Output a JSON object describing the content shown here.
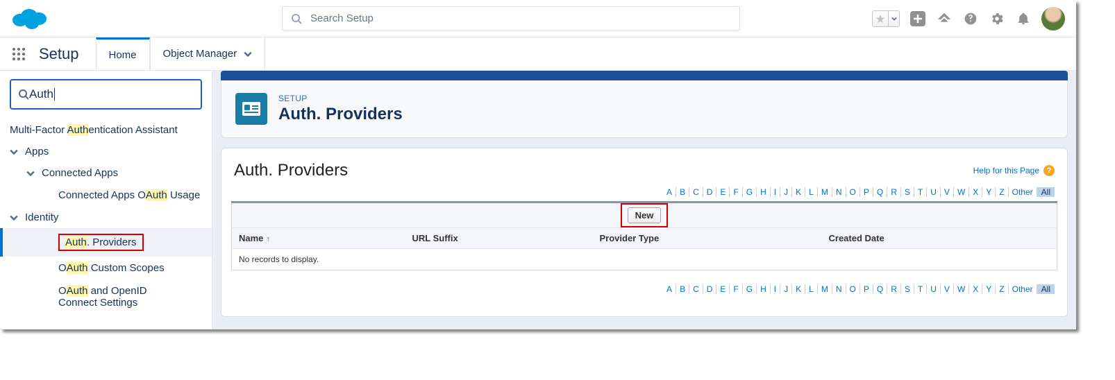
{
  "header": {
    "search_placeholder": "Search Setup"
  },
  "nav": {
    "app_title": "Setup",
    "tab_home": "Home",
    "tab_object_manager": "Object Manager"
  },
  "sidebar": {
    "quickfind_value": "Auth",
    "mfa_prefix": "Multi-Factor ",
    "mfa_hl": "Auth",
    "mfa_suffix": "entication Assistant",
    "apps": "Apps",
    "connected_apps": "Connected Apps",
    "connected_apps_oauth_prefix": "Connected Apps O",
    "connected_apps_oauth_hl": "Auth",
    "connected_apps_oauth_suffix": " Usage",
    "identity": "Identity",
    "auth_providers_hl": "Auth",
    "auth_providers_suffix": ". Providers",
    "oauth_scopes_prefix": "O",
    "oauth_scopes_hl": "Auth",
    "oauth_scopes_suffix": " Custom Scopes",
    "oauth_openid_prefix": "O",
    "oauth_openid_hl": "Auth",
    "oauth_openid_suffix": " and OpenID Connect Settings"
  },
  "main": {
    "breadcrumb": "SETUP",
    "title": "Auth. Providers",
    "list_title": "Auth. Providers",
    "help_link": "Help for this Page",
    "az": [
      "A",
      "B",
      "C",
      "D",
      "E",
      "F",
      "G",
      "H",
      "I",
      "J",
      "K",
      "L",
      "M",
      "N",
      "O",
      "P",
      "Q",
      "R",
      "S",
      "T",
      "U",
      "V",
      "W",
      "X",
      "Y",
      "Z",
      "Other",
      "All"
    ],
    "new_button": "New",
    "columns": {
      "name": "Name",
      "url_suffix": "URL Suffix",
      "provider_type": "Provider Type",
      "created_date": "Created Date"
    },
    "empty": "No records to display."
  }
}
